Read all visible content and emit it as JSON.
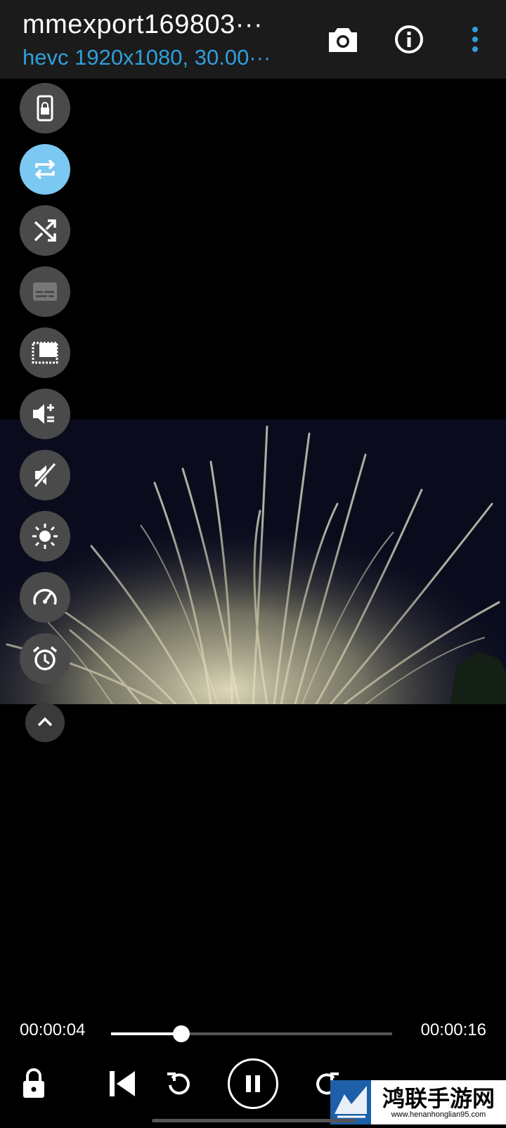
{
  "header": {
    "title": "mmexport169803···",
    "subtitle": "hevc 1920x1080, 30.00···",
    "accent": "#2f9fda"
  },
  "side_buttons": [
    {
      "name": "screen-lock-icon",
      "active": false
    },
    {
      "name": "repeat-icon",
      "active": true
    },
    {
      "name": "shuffle-icon",
      "active": false
    },
    {
      "name": "subtitles-icon",
      "active": false
    },
    {
      "name": "aspect-ratio-icon",
      "active": false
    },
    {
      "name": "volume-boost-icon",
      "active": false
    },
    {
      "name": "mute-icon",
      "active": false
    },
    {
      "name": "brightness-icon",
      "active": false
    },
    {
      "name": "speed-icon",
      "active": false
    },
    {
      "name": "sleep-timer-icon",
      "active": false
    }
  ],
  "player": {
    "current_time": "00:00:04",
    "total_time": "00:00:16",
    "progress": 0.25
  },
  "watermark": {
    "cn_text": "鸿联手游网",
    "url": "www.henanhonglian95.com"
  }
}
